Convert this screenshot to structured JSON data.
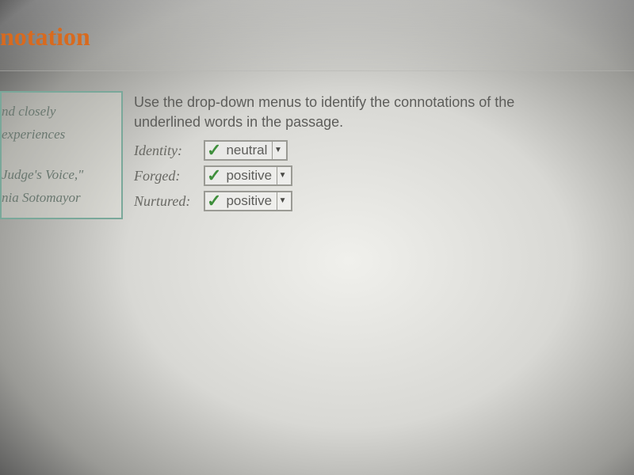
{
  "header": {
    "title": "notation"
  },
  "passage": {
    "lines": [
      "nd closely",
      "experiences",
      "Judge's Voice,\"",
      "nia Sotomayor"
    ]
  },
  "question": {
    "instruction": "Use the drop-down menus to identify the connotations of the underlined words in the passage.",
    "answers": [
      {
        "label": "Identity:",
        "value": "neutral",
        "correct": true
      },
      {
        "label": "Forged:",
        "value": "positive",
        "correct": true
      },
      {
        "label": "Nurtured:",
        "value": "positive",
        "correct": true
      }
    ]
  }
}
